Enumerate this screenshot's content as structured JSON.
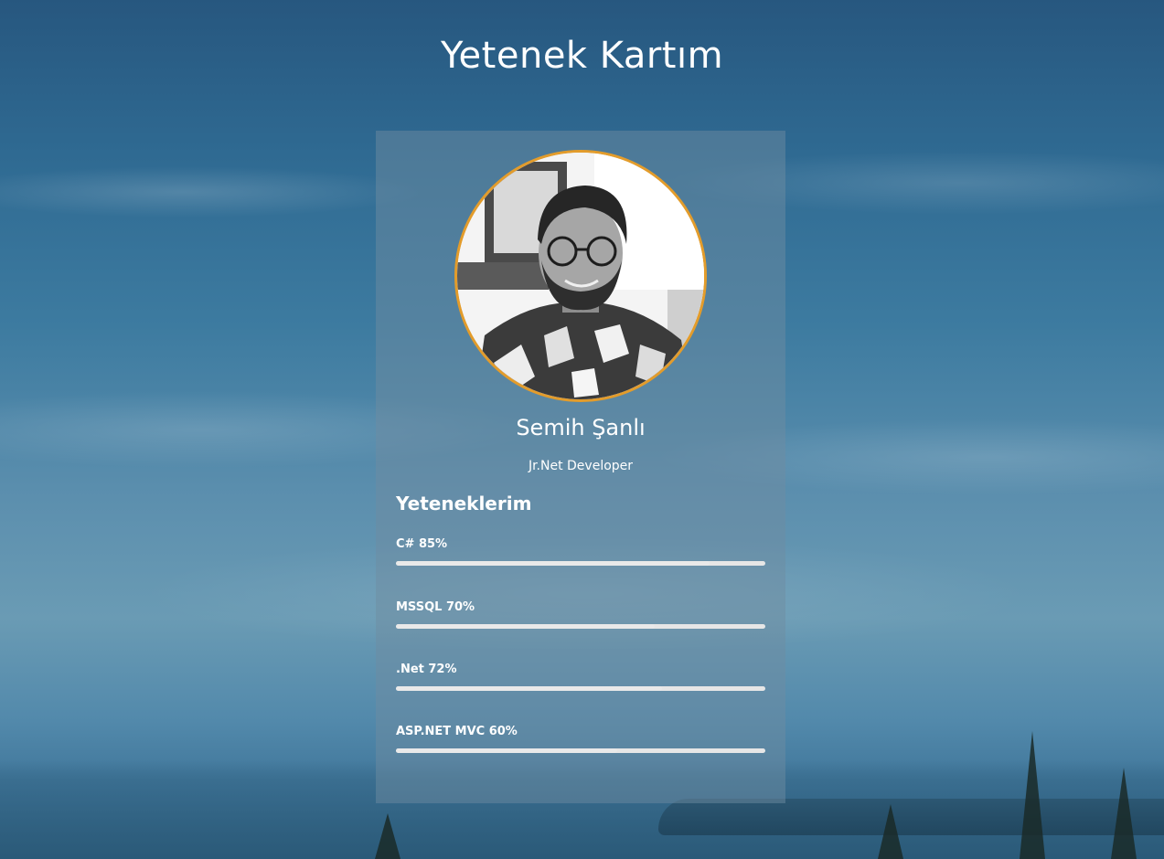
{
  "page": {
    "title": "Yetenek Kartım"
  },
  "profile": {
    "name": "Semih Şanlı",
    "role": "Jr.Net Developer",
    "avatar_icon": "profile-photo",
    "avatar_border_color": "#e39c2b"
  },
  "skills": {
    "heading": "Yeteneklerim",
    "items": [
      {
        "label": "C# 85%",
        "percent": 85
      },
      {
        "label": "MSSQL 70%",
        "percent": 70
      },
      {
        "label": ".Net 72%",
        "percent": 72
      },
      {
        "label": "ASP.NET MVC 60%",
        "percent": 60
      }
    ]
  },
  "colors": {
    "accent": "#e39c2b",
    "text": "#ffffff",
    "bar": "#e6e6e6"
  }
}
